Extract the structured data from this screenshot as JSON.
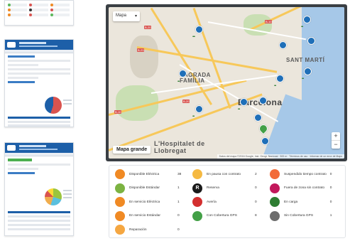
{
  "map": {
    "type_selector": "Mapa",
    "big_map_button": "Mapa grande",
    "zoom_in": "+",
    "zoom_out": "−",
    "labels": {
      "sant_marti": "SANT MARTÍ",
      "sagrada_familia": "SAGRADA FAMÍLIA",
      "barcelona": "Barcelona",
      "hospitalet": "L'Hospitalet de Llobregat"
    },
    "attribution": "Datos del mapa ©2016 Google, Inst. Geogr. Nacional · 500 m · Términos de uso · Informar de un error de Maps"
  },
  "legend": [
    {
      "label": "Disponible Eléctrica",
      "count": "38",
      "color": "#f08a24",
      "icon": "electric-plug-icon"
    },
    {
      "label": "En pausa con contrato",
      "count": "2",
      "color": "#f5b942",
      "icon": "pause-contract-icon"
    },
    {
      "label": "Suspendido tiempo contrato",
      "count": "0",
      "color": "#f26b38",
      "icon": "suspended-icon"
    },
    {
      "label": "Disponible Estándar",
      "count": "1",
      "color": "#7cb342",
      "icon": "standard-plug-icon"
    },
    {
      "label": "Reserva",
      "count": "0",
      "color": "#1a1a1a",
      "icon": "reserve-icon",
      "glyph": "R"
    },
    {
      "label": "Fuera de zona sin contrato",
      "count": "0",
      "color": "#c2185b",
      "icon": "out-of-zone-icon"
    },
    {
      "label": "En servicio Eléctrica",
      "count": "1",
      "color": "#f08a24",
      "icon": "electric-service-icon"
    },
    {
      "label": "Avería",
      "count": "0",
      "color": "#d32f2f",
      "icon": "breakdown-icon"
    },
    {
      "label": "En carga",
      "count": "0",
      "color": "#2e7d32",
      "icon": "charging-icon"
    },
    {
      "label": "En servicio Estándar",
      "count": "0",
      "color": "#f08a24",
      "icon": "standard-service-icon"
    },
    {
      "label": "Con Cobertura GPS",
      "count": "8",
      "color": "#43a047",
      "icon": "gps-on-icon"
    },
    {
      "label": "Sin Cobertura GPS",
      "count": "1",
      "color": "#6d6d6d",
      "icon": "gps-off-icon"
    },
    {
      "label": "Reparación",
      "count": "0",
      "color": "#f5a742",
      "icon": "repair-icon"
    }
  ]
}
